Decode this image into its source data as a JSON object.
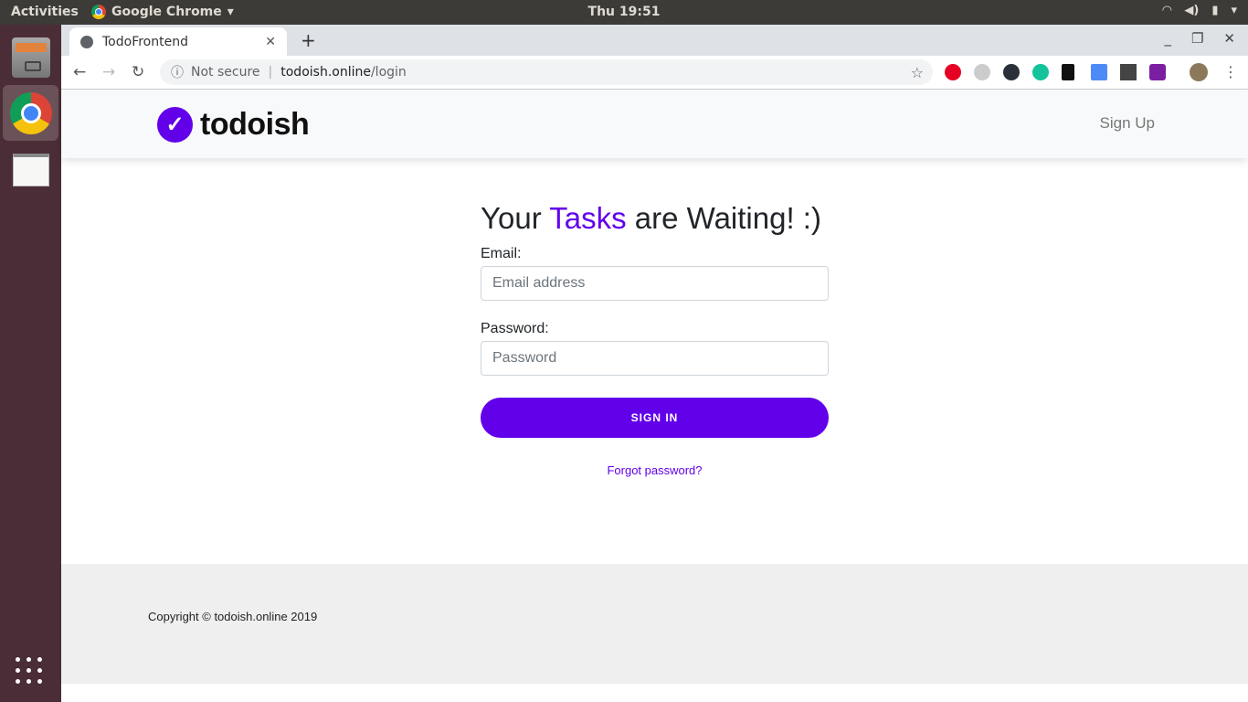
{
  "system": {
    "activities": "Activities",
    "app_name": "Google Chrome",
    "clock": "Thu 19:51"
  },
  "browser": {
    "tab_title": "TodoFrontend",
    "security": "Not secure",
    "url_host": "todoish.online",
    "url_path": "/login"
  },
  "site": {
    "brand": "todoish",
    "signup": "Sign Up",
    "heading_pre": "Your ",
    "heading_accent": "Tasks",
    "heading_post": " are Waiting! :)",
    "email_label": "Email:",
    "email_placeholder": "Email address",
    "password_label": "Password:",
    "password_placeholder": "Password",
    "signin": "SIGN IN",
    "forgot": "Forgot password?",
    "copyright": "Copyright © todoish.online 2019",
    "accent_color": "#6200ea"
  }
}
